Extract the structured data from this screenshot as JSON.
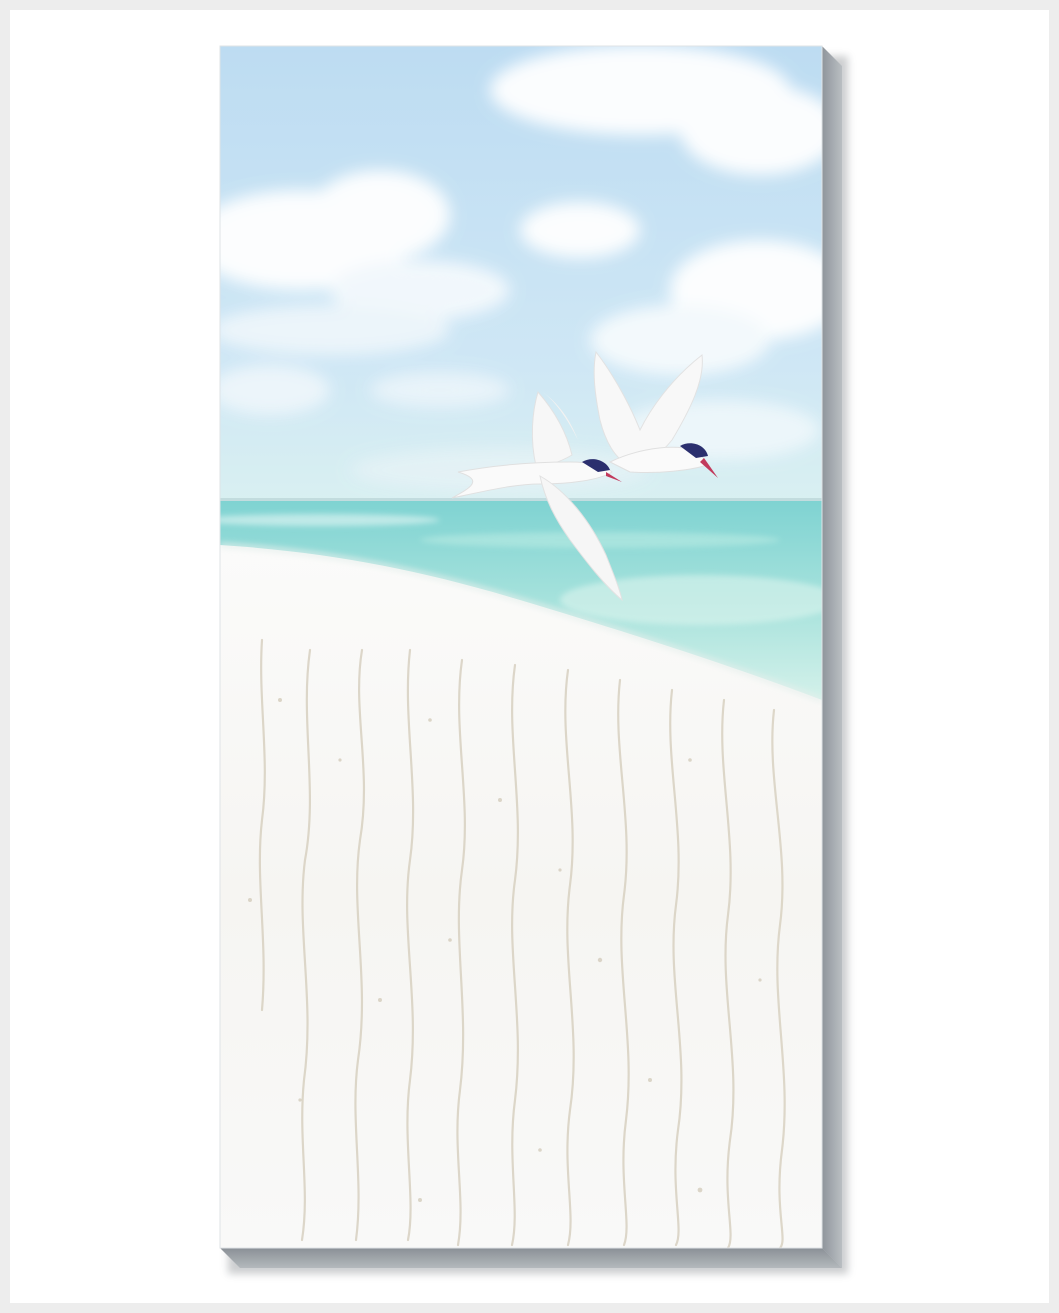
{
  "artwork": {
    "subject": "beach-with-two-terns",
    "colors": {
      "background": "#ededed",
      "mat": "#ffffff",
      "sky_top": "#bfdff3",
      "sky_horizon": "#d4eef2",
      "sea_far": "#8fd8d6",
      "sea_near": "#c3ece4",
      "sand": "#f7f7f5",
      "sand_ripple": "#d9d3c4",
      "canvas_edge": "#a3a8ad",
      "bird_body": "#fbfbfb",
      "bird_cap": "#2b2f6e",
      "bird_beak": "#c23a5c"
    }
  }
}
